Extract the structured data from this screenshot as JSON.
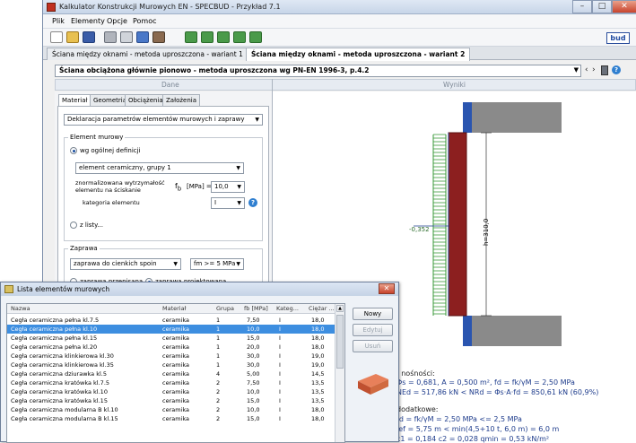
{
  "window": {
    "title": "Kalkulator Konstrukcji Murowych EN - SPECBUD - Przykład 7.1"
  },
  "menu": [
    "Plik",
    "Elementy",
    "Opcje",
    "Pomoc"
  ],
  "logo": "bud",
  "doc_tabs": [
    "Ściana między oknami - metoda uproszczona - wariant 1",
    "Ściana między oknami - metoda uproszczona - wariant 2"
  ],
  "module_select": "Ściana obciążona głównie pionowo - metoda uproszczona wg PN-EN 1996-3, p.4.2",
  "headers": {
    "dane": "Dane",
    "wyniki": "Wyniki"
  },
  "sub_tabs": [
    "Materiał",
    "Geometria",
    "Obciążenia",
    "Założenia"
  ],
  "material": {
    "declaration": "Deklaracja parametrów elementów murowych i zaprawy",
    "group_label": "Element murowy",
    "radio_general": "wg ogólnej definicji",
    "element_type": "element ceramiczny, grupy 1",
    "fb_desc_1": "znormalizowana wytrzymałość",
    "fb_desc_2": "elementu na ściskanie",
    "fb_label": "f",
    "fb_sub": "b",
    "fb_unit": "[MPa] =",
    "fb_value": "10,0",
    "category_label": "kategoria elementu",
    "category_value": "I",
    "radio_list": "z listy...",
    "mortar_group": "Zaprawa",
    "mortar_type": "zaprawa do cienkich spoin",
    "mortar_strength": "fm >= 5 MPa",
    "radio_prescribed": "zaprawa przepisana",
    "radio_designed": "zaprawa projektowana"
  },
  "results": {
    "top_dim": "t=0,18",
    "bottom_dim": "t=0,18",
    "height": "h=310,0",
    "load": "-0,352",
    "line1": ": nośności:",
    "line2": "Φs = 0,681,  A = 0,500 m²,  fd = fk/γM = 2,50 MPa",
    "line3": "NEd = 517,86 kN  <  NRd = Φs·A·fd = 850,61 kN     (60,9%)",
    "line4": "dodatkowe:",
    "line5": "fd = fk/γM = 2,50 MPa <= 2,5 MPa",
    "line6": "lef = 5,75 m < min(4,5+10 t, 6,0 m) = 6,0 m",
    "line7": "c1 = 0,184    c2 = 0,028    qmin = 0,53 kN/m²"
  },
  "dialog": {
    "title": "Lista elementów murowych",
    "columns": [
      "Nazwa",
      "Materiał",
      "Grupa",
      "fb [MPa]",
      "Kateg...",
      "Ciężar ..."
    ],
    "rows": [
      [
        "Cegła ceramiczna pełna kl.7.5",
        "ceramika",
        "1",
        "7,50",
        "I",
        "18,0"
      ],
      [
        "Cegła ceramiczna pełna kl.10",
        "ceramika",
        "1",
        "10,0",
        "I",
        "18,0"
      ],
      [
        "Cegła ceramiczna pełna kl.15",
        "ceramika",
        "1",
        "15,0",
        "I",
        "18,0"
      ],
      [
        "Cegła ceramiczna pełna kl.20",
        "ceramika",
        "1",
        "20,0",
        "I",
        "18,0"
      ],
      [
        "Cegła ceramiczna klinkierowa kl.30",
        "ceramika",
        "1",
        "30,0",
        "I",
        "19,0"
      ],
      [
        "Cegła ceramiczna klinkierowa kl.35",
        "ceramika",
        "1",
        "30,0",
        "I",
        "19,0"
      ],
      [
        "Cegła ceramiczna dziurawka kl.5",
        "ceramika",
        "4",
        "5,00",
        "I",
        "14,5"
      ],
      [
        "Cegła ceramiczna kratówka kl.7.5",
        "ceramika",
        "2",
        "7,50",
        "I",
        "13,5"
      ],
      [
        "Cegła ceramiczna kratówka kl.10",
        "ceramika",
        "2",
        "10,0",
        "I",
        "13,5"
      ],
      [
        "Cegła ceramiczna kratówka kl.15",
        "ceramika",
        "2",
        "15,0",
        "I",
        "13,5"
      ],
      [
        "Cegła ceramiczna modularna B kl.10",
        "ceramika",
        "2",
        "10,0",
        "I",
        "18,0"
      ],
      [
        "Cegła ceramiczna modularna B kl.15",
        "ceramika",
        "2",
        "15,0",
        "I",
        "18,0"
      ]
    ],
    "selected_row": 1,
    "buttons": {
      "new": "Nowy",
      "edit": "Edytuj",
      "delete": "Usuń"
    }
  },
  "colors": {
    "wall": "#8c1f1f",
    "load": "#1e3c8c",
    "mesh": "#3a9a3a"
  }
}
